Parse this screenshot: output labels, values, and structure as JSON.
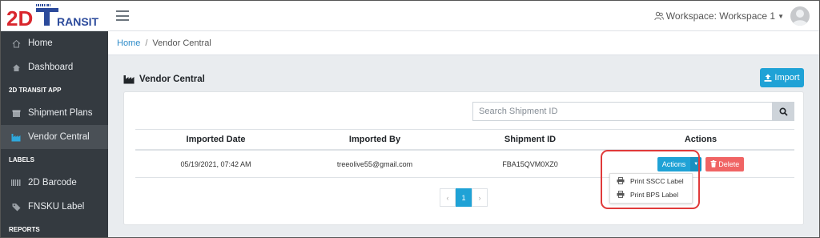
{
  "brand": {
    "logo_text": "2DTRANSIT",
    "colors": {
      "accent": "#1fa2d6",
      "brand_red": "#d9272e",
      "brand_blue": "#2b4a9b",
      "sidebar": "#343a40",
      "delete": "#f06464",
      "highlight": "#e03a3a"
    }
  },
  "header": {
    "workspace_label": "Workspace: Workspace 1",
    "workspace_icon": "user-group-icon",
    "menu_icon": "hamburger-icon"
  },
  "sidebar": {
    "items": [
      {
        "type": "item",
        "label": "Home",
        "icon": "home-icon"
      },
      {
        "type": "item",
        "label": "Dashboard",
        "icon": "dashboard-icon"
      },
      {
        "type": "section",
        "label": "2D TRANSIT APP"
      },
      {
        "type": "item",
        "label": "Shipment Plans",
        "icon": "box-icon"
      },
      {
        "type": "item",
        "label": "Vendor Central",
        "icon": "factory-icon",
        "active": true
      },
      {
        "type": "section",
        "label": "LABELS"
      },
      {
        "type": "item",
        "label": "2D Barcode",
        "icon": "barcode-icon"
      },
      {
        "type": "item",
        "label": "FNSKU Label",
        "icon": "tag-icon"
      },
      {
        "type": "section",
        "label": "REPORTS"
      }
    ]
  },
  "breadcrumb": {
    "home": "Home",
    "current": "Vendor Central"
  },
  "page": {
    "title": "Vendor Central",
    "import_label": "Import"
  },
  "search": {
    "placeholder": "Search Shipment ID"
  },
  "table": {
    "headers": [
      "Imported Date",
      "Imported By",
      "Shipment ID",
      "Actions"
    ],
    "rows": [
      {
        "date": "05/19/2021, 07:42 AM",
        "by": "treeolive55@gmail.com",
        "shipment_id": "FBA15QVM0XZ0"
      }
    ],
    "actions_label": "Actions",
    "delete_label": "Delete"
  },
  "dropdown": {
    "items": [
      "Print SSCC Label",
      "Print BPS Label"
    ]
  },
  "pagination": {
    "prev": "‹",
    "current": "1",
    "next": "›"
  }
}
